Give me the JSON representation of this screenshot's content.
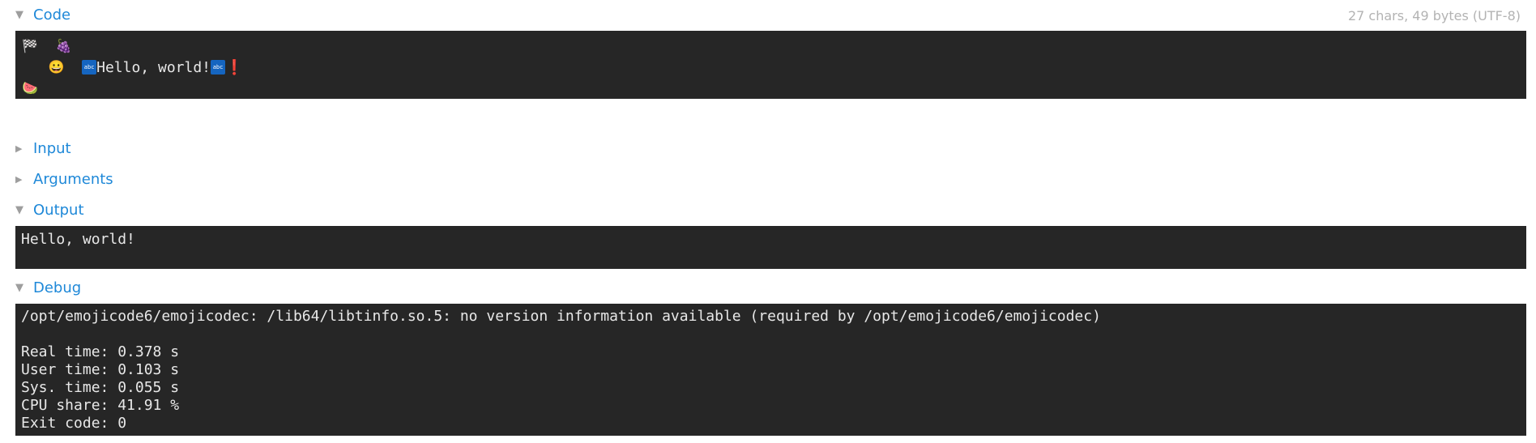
{
  "code_section": {
    "title": "Code",
    "stats": "27 chars, 49 bytes (UTF-8)",
    "lines": {
      "line1": {
        "flag": "🏁",
        "grapes": "🍇"
      },
      "line2": {
        "face": "😀",
        "abc_icon": "abc",
        "text": "Hello, world!",
        "abc_icon2": "abc",
        "bang": "❗"
      },
      "line3": {
        "watermelon": "🍉"
      }
    }
  },
  "input_section": {
    "title": "Input"
  },
  "arguments_section": {
    "title": "Arguments"
  },
  "output_section": {
    "title": "Output",
    "text": "Hello, world!"
  },
  "debug_section": {
    "title": "Debug",
    "lines": [
      "/opt/emojicode6/emojicodec: /lib64/libtinfo.so.5: no version information available (required by /opt/emojicode6/emojicodec)",
      "",
      "Real time: 0.378 s",
      "User time: 0.103 s",
      "Sys. time: 0.055 s",
      "CPU share: 41.91 %",
      "Exit code: 0"
    ]
  },
  "icons": {
    "expanded": "triangle-down-icon",
    "collapsed": "triangle-right-icon"
  },
  "colors": {
    "accent": "#1e88d8",
    "panel_bg": "#262626",
    "panel_text": "#e8e8e8",
    "stats_text": "#b3b3b3"
  }
}
